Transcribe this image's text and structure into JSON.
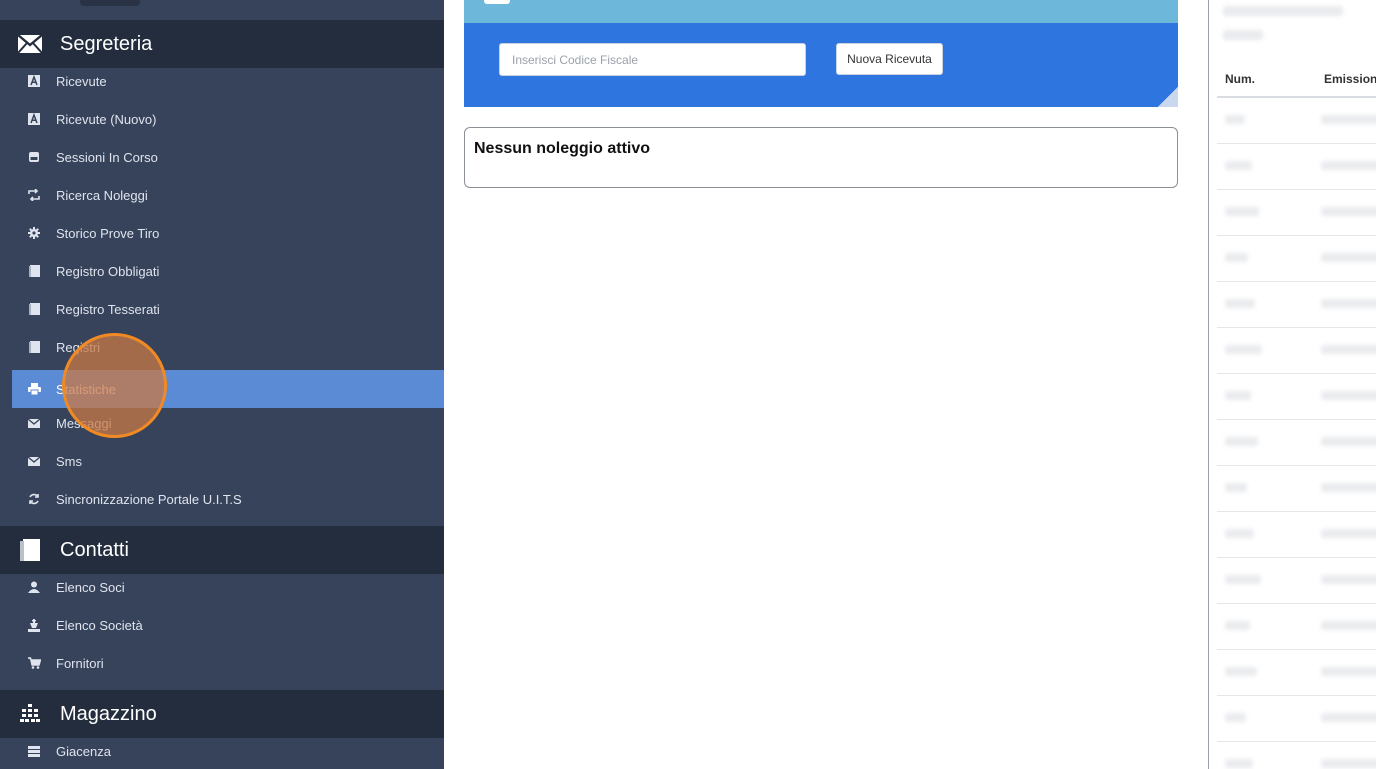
{
  "sidebar": {
    "sections": [
      {
        "id": "segreteria",
        "title": "Segreteria",
        "icon": "envelope-icon",
        "items": [
          {
            "label": "Ricevute",
            "icon": "font-icon"
          },
          {
            "label": "Ricevute (Nuovo)",
            "icon": "font-icon"
          },
          {
            "label": "Sessioni In Corso",
            "icon": "hdd-icon"
          },
          {
            "label": "Ricerca Noleggi",
            "icon": "retweet-icon"
          },
          {
            "label": "Storico Prove Tiro",
            "icon": "cog-icon"
          },
          {
            "label": "Registro Obbligati",
            "icon": "book-icon"
          },
          {
            "label": "Registro Tesserati",
            "icon": "book-icon"
          },
          {
            "label": "Registri",
            "icon": "book-icon"
          },
          {
            "label": "Statistiche",
            "icon": "print-icon",
            "active": true
          },
          {
            "label": "Messaggi",
            "icon": "envelope-icon"
          },
          {
            "label": "Sms",
            "icon": "envelope-icon"
          },
          {
            "label": "Sincronizzazione Portale U.I.T.S",
            "icon": "refresh-icon"
          }
        ]
      },
      {
        "id": "contatti",
        "title": "Contatti",
        "icon": "book-icon",
        "items": [
          {
            "label": "Elenco Soci",
            "icon": "user-icon"
          },
          {
            "label": "Elenco Società",
            "icon": "king-icon"
          },
          {
            "label": "Fornitori",
            "icon": "shopping-cart-icon"
          }
        ]
      },
      {
        "id": "magazzino",
        "title": "Magazzino",
        "icon": "tasks-grid-icon",
        "items": [
          {
            "label": "Giacenza",
            "icon": "list-icon"
          }
        ]
      }
    ]
  },
  "main": {
    "codice_fiscale_placeholder": "Inserisci Codice Fiscale",
    "codice_fiscale_value": "",
    "new_receipt_label": "Nuova Ricevuta",
    "rental_status": "Nessun noleggio attivo"
  },
  "right_panel": {
    "columns": [
      "Num.",
      "Emission"
    ]
  },
  "colors": {
    "sidebar_bg": "#37435a",
    "section_header_bg": "#242d3d",
    "active_item_bg": "#5b8bd4",
    "panel_blue": "#2e75e0",
    "panel_top_light": "#6db8da",
    "click_indicator": "#f08a24"
  }
}
